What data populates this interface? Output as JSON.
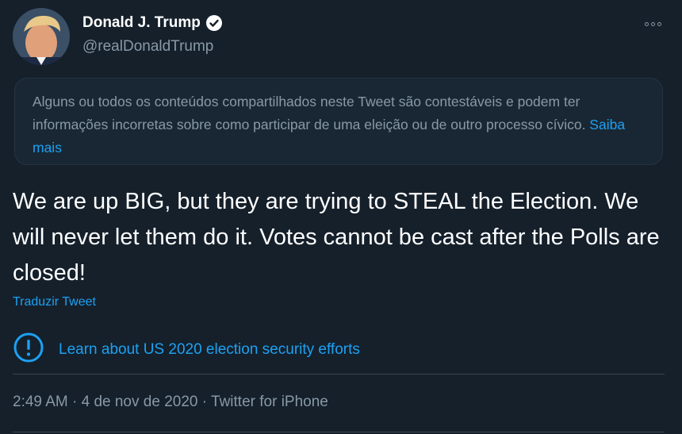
{
  "author": {
    "display_name": "Donald J. Trump",
    "handle": "@realDonaldTrump",
    "verified": true
  },
  "notice": {
    "text": "Alguns ou todos os conteúdos compartilhados neste Tweet são contestáveis e podem ter informações incorretas sobre como participar de uma eleição ou de outro processo cívico. ",
    "link_label": "Saiba mais"
  },
  "tweet": {
    "text": "We are up BIG, but they are trying to STEAL the Election. We will never let them do it. Votes cannot be cast after the Polls are closed!",
    "translate_label": "Traduzir Tweet"
  },
  "election_info": {
    "label": "Learn about US 2020 election security efforts"
  },
  "meta": {
    "time": "2:49 AM",
    "separator": " · ",
    "date": "4 de nov de 2020",
    "source": "Twitter for iPhone"
  },
  "colors": {
    "background": "#15202b",
    "accent": "#1da1f2",
    "secondary_text": "#8899a6"
  }
}
